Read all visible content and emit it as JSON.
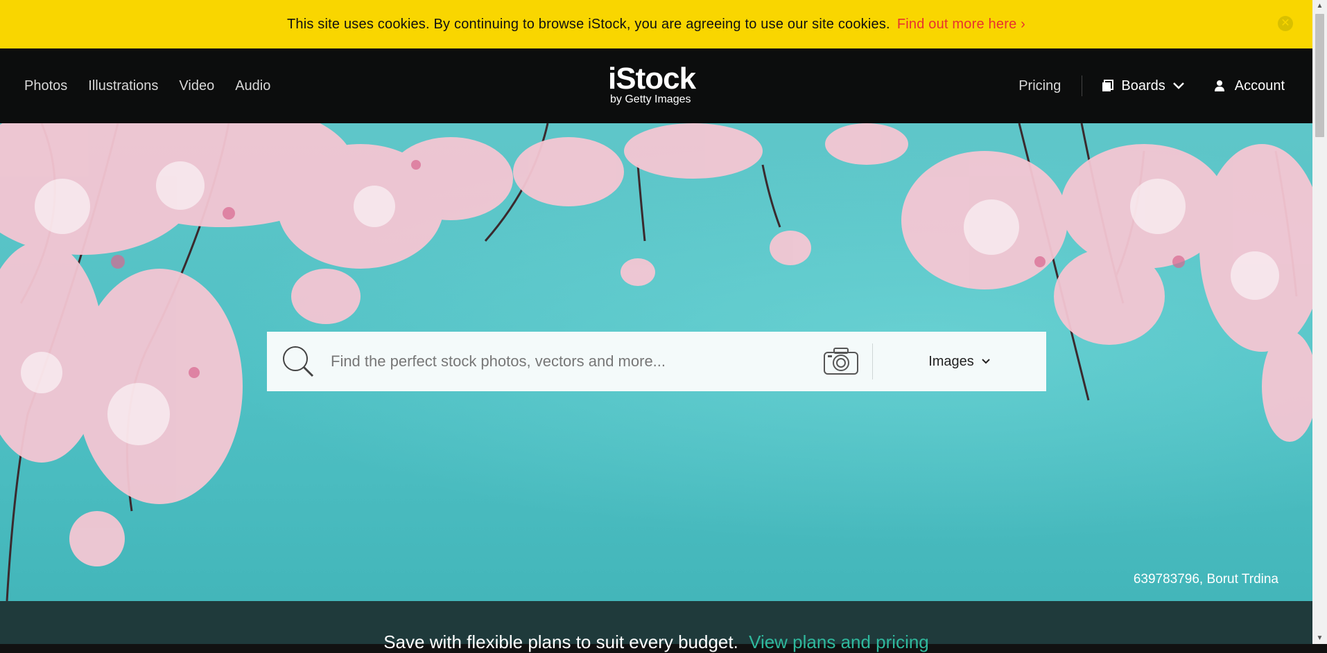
{
  "cookie": {
    "message": "This site uses cookies. By continuing to browse iStock, you are agreeing to use our site cookies.",
    "link": "Find out more here ›",
    "close_icon": "close-icon"
  },
  "nav": {
    "items": [
      {
        "label": "Photos"
      },
      {
        "label": "Illustrations"
      },
      {
        "label": "Video"
      },
      {
        "label": "Audio"
      }
    ],
    "logo": {
      "main": "iStock",
      "sub": "by Getty Images"
    },
    "pricing": "Pricing",
    "boards": "Boards",
    "account": "Account"
  },
  "search": {
    "placeholder": "Find the perfect stock photos, vectors and more...",
    "type": "Images"
  },
  "hero": {
    "credit": "639783796, Borut Trdina"
  },
  "promo": {
    "text": "Save with flexible plans to suit every budget.",
    "link": "View plans and pricing"
  },
  "colors": {
    "cookie_bg": "#f9d600",
    "nav_bg": "#0c0d0d",
    "sky": "#4fc0c4",
    "link_red": "#e8312f",
    "promo_green": "#2fb89c"
  }
}
